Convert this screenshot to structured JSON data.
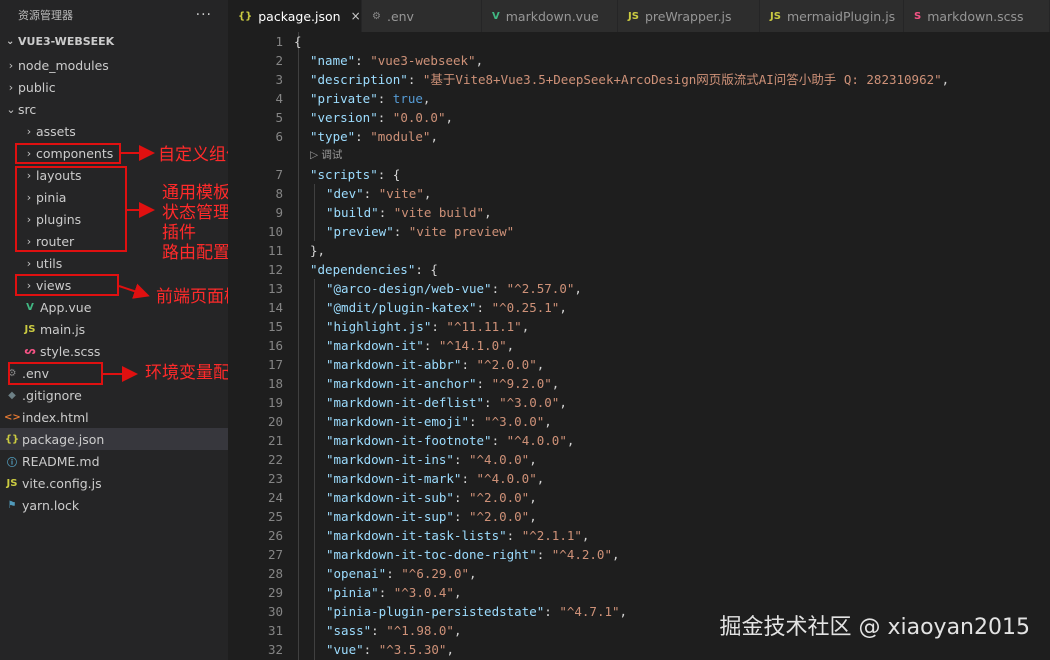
{
  "sidebar": {
    "title": "资源管理器",
    "more": "···",
    "root": "VUE3-WEBSEEK",
    "items": [
      {
        "label": "node_modules",
        "type": "folder",
        "depth": 1
      },
      {
        "label": "public",
        "type": "folder",
        "depth": 1
      },
      {
        "label": "src",
        "type": "folder-open",
        "depth": 1
      },
      {
        "label": "assets",
        "type": "folder",
        "depth": 2
      },
      {
        "label": "components",
        "type": "folder",
        "depth": 2
      },
      {
        "label": "layouts",
        "type": "folder",
        "depth": 2
      },
      {
        "label": "pinia",
        "type": "folder",
        "depth": 2
      },
      {
        "label": "plugins",
        "type": "folder",
        "depth": 2
      },
      {
        "label": "router",
        "type": "folder",
        "depth": 2
      },
      {
        "label": "utils",
        "type": "folder",
        "depth": 2
      },
      {
        "label": "views",
        "type": "folder",
        "depth": 2
      },
      {
        "label": "App.vue",
        "type": "vue",
        "depth": 2
      },
      {
        "label": "main.js",
        "type": "js",
        "depth": 2
      },
      {
        "label": "style.scss",
        "type": "scss",
        "depth": 2
      },
      {
        "label": ".env",
        "type": "gear",
        "depth": 1
      },
      {
        "label": ".gitignore",
        "type": "git",
        "depth": 1
      },
      {
        "label": "index.html",
        "type": "html",
        "depth": 1
      },
      {
        "label": "package.json",
        "type": "json",
        "depth": 1
      },
      {
        "label": "README.md",
        "type": "info",
        "depth": 1
      },
      {
        "label": "vite.config.js",
        "type": "js",
        "depth": 1
      },
      {
        "label": "yarn.lock",
        "type": "yarn",
        "depth": 1
      }
    ]
  },
  "annotations": {
    "components": "自定义组件",
    "group": [
      "通用模板",
      "状态管理",
      "插件",
      "路由配置"
    ],
    "views": "前端页面模板",
    "env": "环境变量配置"
  },
  "tabs": [
    {
      "label": "package.json",
      "icon": "{}",
      "active": true,
      "close": "×"
    },
    {
      "label": ".env",
      "icon": "⚙",
      "active": false
    },
    {
      "label": "markdown.vue",
      "icon": "V",
      "active": false
    },
    {
      "label": "preWrapper.js",
      "icon": "JS",
      "active": false
    },
    {
      "label": "mermaidPlugin.js",
      "icon": "JS",
      "active": false
    },
    {
      "label": "markdown.scss",
      "icon": "S",
      "active": false
    }
  ],
  "editor": {
    "lens_label": "调试",
    "lines": [
      {
        "n": 1,
        "indent": 0,
        "tokens": [
          [
            "{",
            "p"
          ]
        ]
      },
      {
        "n": 2,
        "indent": 1,
        "tokens": [
          [
            "\"name\"",
            "k"
          ],
          [
            ": ",
            "p"
          ],
          [
            "\"vue3-webseek\"",
            "s"
          ],
          [
            ",",
            "p"
          ]
        ]
      },
      {
        "n": 3,
        "indent": 1,
        "tokens": [
          [
            "\"description\"",
            "k"
          ],
          [
            ": ",
            "p"
          ],
          [
            "\"基于Vite8+Vue3.5+DeepSeek+ArcoDesign网页版流式AI问答小助手 Q: 282310962\"",
            "s"
          ],
          [
            ",",
            "p"
          ]
        ]
      },
      {
        "n": 4,
        "indent": 1,
        "tokens": [
          [
            "\"private\"",
            "k"
          ],
          [
            ": ",
            "p"
          ],
          [
            "true",
            "b"
          ],
          [
            ",",
            "p"
          ]
        ]
      },
      {
        "n": 5,
        "indent": 1,
        "tokens": [
          [
            "\"version\"",
            "k"
          ],
          [
            ": ",
            "p"
          ],
          [
            "\"0.0.0\"",
            "s"
          ],
          [
            ",",
            "p"
          ]
        ]
      },
      {
        "n": 6,
        "indent": 1,
        "tokens": [
          [
            "\"type\"",
            "k"
          ],
          [
            ": ",
            "p"
          ],
          [
            "\"module\"",
            "s"
          ],
          [
            ",",
            "p"
          ]
        ]
      },
      {
        "lens": true
      },
      {
        "n": 7,
        "indent": 1,
        "tokens": [
          [
            "\"scripts\"",
            "k"
          ],
          [
            ": {",
            "p"
          ]
        ]
      },
      {
        "n": 8,
        "indent": 2,
        "tokens": [
          [
            "\"dev\"",
            "k"
          ],
          [
            ": ",
            "p"
          ],
          [
            "\"vite\"",
            "s"
          ],
          [
            ",",
            "p"
          ]
        ]
      },
      {
        "n": 9,
        "indent": 2,
        "tokens": [
          [
            "\"build\"",
            "k"
          ],
          [
            ": ",
            "p"
          ],
          [
            "\"vite build\"",
            "s"
          ],
          [
            ",",
            "p"
          ]
        ]
      },
      {
        "n": 10,
        "indent": 2,
        "tokens": [
          [
            "\"preview\"",
            "k"
          ],
          [
            ": ",
            "p"
          ],
          [
            "\"vite preview\"",
            "s"
          ]
        ]
      },
      {
        "n": 11,
        "indent": 1,
        "tokens": [
          [
            "},",
            "p"
          ]
        ]
      },
      {
        "n": 12,
        "indent": 1,
        "tokens": [
          [
            "\"dependencies\"",
            "k"
          ],
          [
            ": {",
            "p"
          ]
        ]
      },
      {
        "n": 13,
        "indent": 2,
        "tokens": [
          [
            "\"@arco-design/web-vue\"",
            "k"
          ],
          [
            ": ",
            "p"
          ],
          [
            "\"^2.57.0\"",
            "s"
          ],
          [
            ",",
            "p"
          ]
        ]
      },
      {
        "n": 14,
        "indent": 2,
        "tokens": [
          [
            "\"@mdit/plugin-katex\"",
            "k"
          ],
          [
            ": ",
            "p"
          ],
          [
            "\"^0.25.1\"",
            "s"
          ],
          [
            ",",
            "p"
          ]
        ]
      },
      {
        "n": 15,
        "indent": 2,
        "tokens": [
          [
            "\"highlight.js\"",
            "k"
          ],
          [
            ": ",
            "p"
          ],
          [
            "\"^11.11.1\"",
            "s"
          ],
          [
            ",",
            "p"
          ]
        ]
      },
      {
        "n": 16,
        "indent": 2,
        "tokens": [
          [
            "\"markdown-it\"",
            "k"
          ],
          [
            ": ",
            "p"
          ],
          [
            "\"^14.1.0\"",
            "s"
          ],
          [
            ",",
            "p"
          ]
        ]
      },
      {
        "n": 17,
        "indent": 2,
        "tokens": [
          [
            "\"markdown-it-abbr\"",
            "k"
          ],
          [
            ": ",
            "p"
          ],
          [
            "\"^2.0.0\"",
            "s"
          ],
          [
            ",",
            "p"
          ]
        ]
      },
      {
        "n": 18,
        "indent": 2,
        "tokens": [
          [
            "\"markdown-it-anchor\"",
            "k"
          ],
          [
            ": ",
            "p"
          ],
          [
            "\"^9.2.0\"",
            "s"
          ],
          [
            ",",
            "p"
          ]
        ]
      },
      {
        "n": 19,
        "indent": 2,
        "tokens": [
          [
            "\"markdown-it-deflist\"",
            "k"
          ],
          [
            ": ",
            "p"
          ],
          [
            "\"^3.0.0\"",
            "s"
          ],
          [
            ",",
            "p"
          ]
        ]
      },
      {
        "n": 20,
        "indent": 2,
        "tokens": [
          [
            "\"markdown-it-emoji\"",
            "k"
          ],
          [
            ": ",
            "p"
          ],
          [
            "\"^3.0.0\"",
            "s"
          ],
          [
            ",",
            "p"
          ]
        ]
      },
      {
        "n": 21,
        "indent": 2,
        "tokens": [
          [
            "\"markdown-it-footnote\"",
            "k"
          ],
          [
            ": ",
            "p"
          ],
          [
            "\"^4.0.0\"",
            "s"
          ],
          [
            ",",
            "p"
          ]
        ]
      },
      {
        "n": 22,
        "indent": 2,
        "tokens": [
          [
            "\"markdown-it-ins\"",
            "k"
          ],
          [
            ": ",
            "p"
          ],
          [
            "\"^4.0.0\"",
            "s"
          ],
          [
            ",",
            "p"
          ]
        ]
      },
      {
        "n": 23,
        "indent": 2,
        "tokens": [
          [
            "\"markdown-it-mark\"",
            "k"
          ],
          [
            ": ",
            "p"
          ],
          [
            "\"^4.0.0\"",
            "s"
          ],
          [
            ",",
            "p"
          ]
        ]
      },
      {
        "n": 24,
        "indent": 2,
        "tokens": [
          [
            "\"markdown-it-sub\"",
            "k"
          ],
          [
            ": ",
            "p"
          ],
          [
            "\"^2.0.0\"",
            "s"
          ],
          [
            ",",
            "p"
          ]
        ]
      },
      {
        "n": 25,
        "indent": 2,
        "tokens": [
          [
            "\"markdown-it-sup\"",
            "k"
          ],
          [
            ": ",
            "p"
          ],
          [
            "\"^2.0.0\"",
            "s"
          ],
          [
            ",",
            "p"
          ]
        ]
      },
      {
        "n": 26,
        "indent": 2,
        "tokens": [
          [
            "\"markdown-it-task-lists\"",
            "k"
          ],
          [
            ": ",
            "p"
          ],
          [
            "\"^2.1.1\"",
            "s"
          ],
          [
            ",",
            "p"
          ]
        ]
      },
      {
        "n": 27,
        "indent": 2,
        "tokens": [
          [
            "\"markdown-it-toc-done-right\"",
            "k"
          ],
          [
            ": ",
            "p"
          ],
          [
            "\"^4.2.0\"",
            "s"
          ],
          [
            ",",
            "p"
          ]
        ]
      },
      {
        "n": 28,
        "indent": 2,
        "tokens": [
          [
            "\"openai\"",
            "k"
          ],
          [
            ": ",
            "p"
          ],
          [
            "\"^6.29.0\"",
            "s"
          ],
          [
            ",",
            "p"
          ]
        ]
      },
      {
        "n": 29,
        "indent": 2,
        "tokens": [
          [
            "\"pinia\"",
            "k"
          ],
          [
            ": ",
            "p"
          ],
          [
            "\"^3.0.4\"",
            "s"
          ],
          [
            ",",
            "p"
          ]
        ]
      },
      {
        "n": 30,
        "indent": 2,
        "tokens": [
          [
            "\"pinia-plugin-persistedstate\"",
            "k"
          ],
          [
            ": ",
            "p"
          ],
          [
            "\"^4.7.1\"",
            "s"
          ],
          [
            ",",
            "p"
          ]
        ]
      },
      {
        "n": 31,
        "indent": 2,
        "tokens": [
          [
            "\"sass\"",
            "k"
          ],
          [
            ": ",
            "p"
          ],
          [
            "\"^1.98.0\"",
            "s"
          ],
          [
            ",",
            "p"
          ]
        ]
      },
      {
        "n": 32,
        "indent": 2,
        "tokens": [
          [
            "\"vue\"",
            "k"
          ],
          [
            ": ",
            "p"
          ],
          [
            "\"^3.5.30\"",
            "s"
          ],
          [
            ",",
            "p"
          ]
        ]
      }
    ]
  },
  "watermark": "掘金技术社区 @ xiaoyan2015",
  "colors": {
    "annotation": "#e01010",
    "vue": "#41b883",
    "js": "#cbcb41",
    "json": "#cbcb41",
    "scss": "#f55385",
    "html": "#e37933",
    "info": "#519aba",
    "yarn": "#519aba",
    "gear": "#8a8a8a",
    "git": "#6d8086"
  }
}
